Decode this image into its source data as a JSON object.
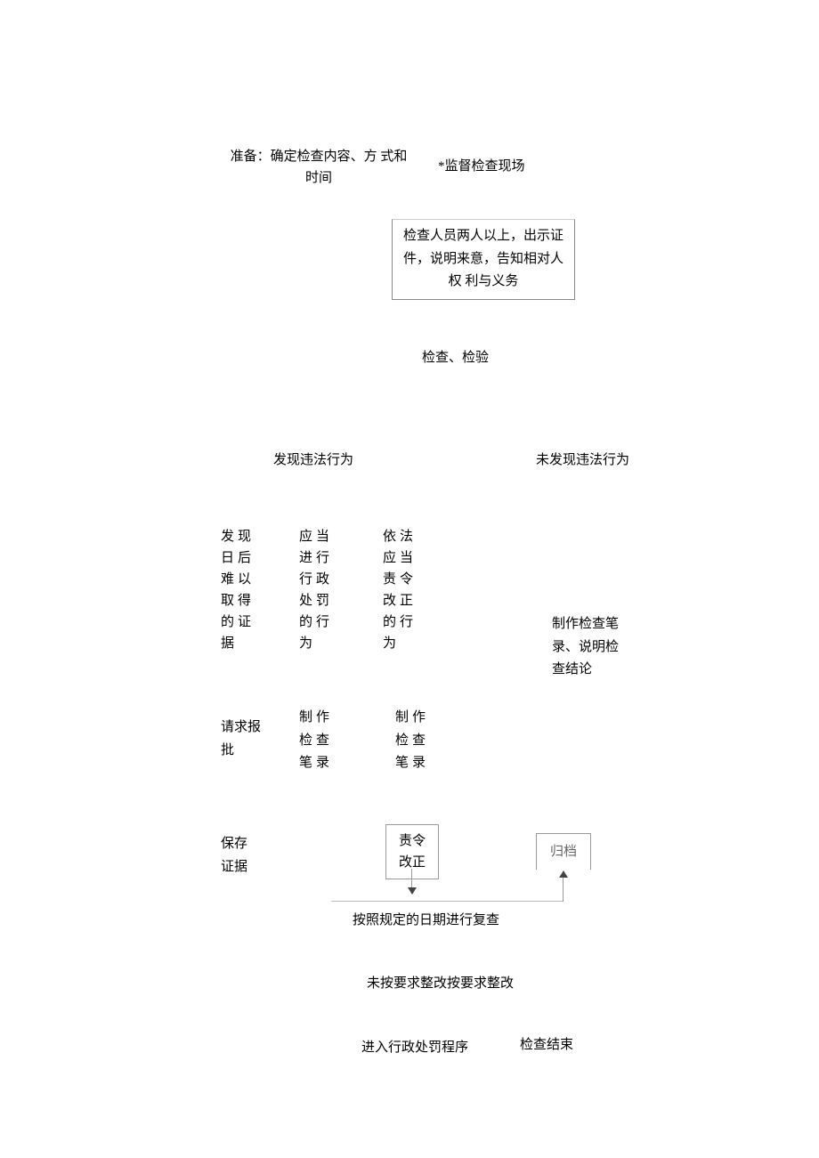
{
  "top": {
    "prep": "准备：确定检查内容、方\n式和时间",
    "site": "*监督检查现场"
  },
  "notice": "检查人员两人以上，出示证\n件，说明来意，告知相对人权\n利与义务",
  "step_check": "检查、检验",
  "branch": {
    "found": "发现违法行为",
    "not_found": "未发现违法行为"
  },
  "cols": {
    "c1": "发现日后难以取得的证据",
    "c2": "应当进行行政处罚的行为",
    "c3": "依法应当责令改正的行为"
  },
  "right_note": "制作检查笔\n录、说明检\n查结论",
  "mid": {
    "m1": "请求报\n批",
    "m2": "制作\n检查\n笔录",
    "m3": "制作\n检查\n笔录"
  },
  "lower": {
    "save": "保存\n证据",
    "order": "责令\n改正",
    "archive": "归档"
  },
  "recheck": "按照规定的日期进行复查",
  "correction": "未按要求整改按要求整改",
  "outcome": {
    "penalty": "进入行政处罚程序",
    "end": "检查结束"
  }
}
